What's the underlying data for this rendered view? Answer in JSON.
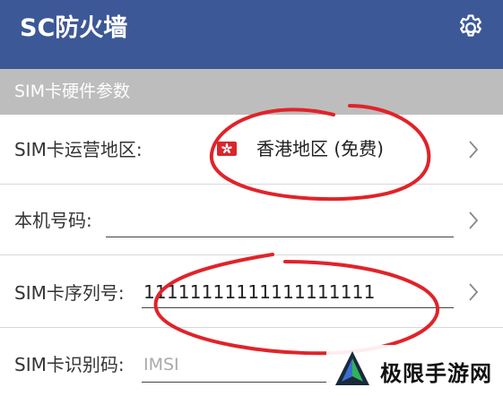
{
  "app": {
    "title": "SC防火墙",
    "settings_icon": "gear-icon"
  },
  "section": {
    "title": "SIM卡硬件参数"
  },
  "rows": {
    "region": {
      "label": "SIM卡运营地区:",
      "value": "香港地区 (免费)",
      "flag_icon": "hong-kong-flag-icon"
    },
    "phone": {
      "label": "本机号码:",
      "value": ""
    },
    "serial": {
      "label": "SIM卡序列号:",
      "value": "11111111111111111111"
    },
    "imsi": {
      "label": "SIM卡识别码:",
      "placeholder": "IMSI"
    }
  },
  "watermark": {
    "text": "极限手游网"
  },
  "colors": {
    "appbar": "#3d5897",
    "section": "#bdbdbd",
    "annotation": "#e0232a"
  }
}
